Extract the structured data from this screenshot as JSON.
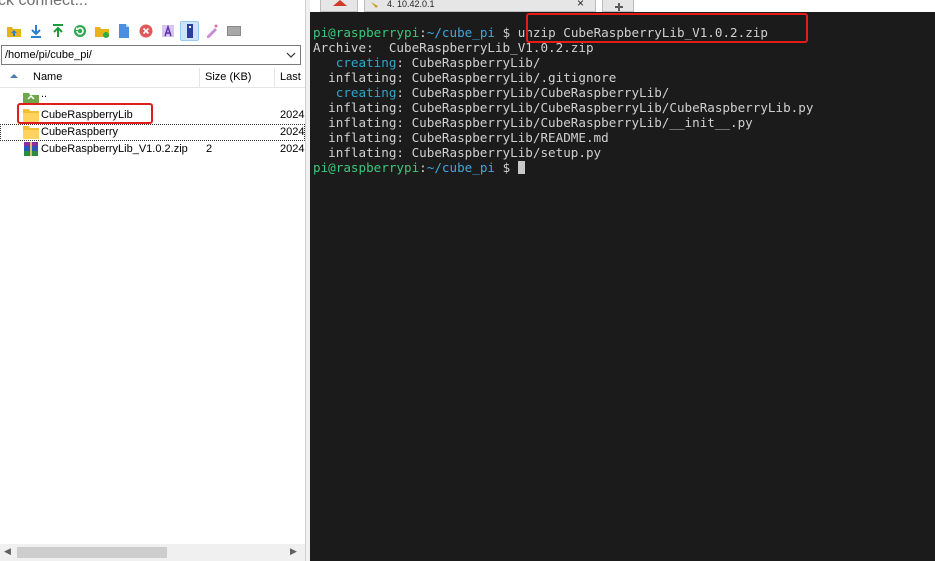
{
  "left_pane": {
    "quick_connect": "ck connect...",
    "path": "/home/pi/cube_pi/",
    "columns": {
      "name": "Name",
      "size": "Size (KB)",
      "last": "Last"
    },
    "files": [
      {
        "name": "..",
        "size": "",
        "date": ""
      },
      {
        "name": "CubeRaspberryLib",
        "size": "",
        "date": "2024"
      },
      {
        "name": "CubeRaspberry",
        "size": "",
        "date": "2024"
      },
      {
        "name": "CubeRaspberryLib_V1.0.2.zip",
        "size": "2",
        "date": "2024"
      }
    ],
    "toolbar_icons": [
      "folder-up-icon",
      "download-icon",
      "upload-icon",
      "refresh-icon",
      "new-folder-icon",
      "new-file-icon",
      "delete-icon",
      "rename-icon",
      "properties-icon",
      "edit-icon",
      "terminal-icon"
    ]
  },
  "terminal": {
    "tab_title": "4. 10.42.0.1",
    "tab_close": "×",
    "prompt_user": "pi@raspberrypi",
    "prompt_sep": ":",
    "prompt_path": "~/cube_pi",
    "prompt_symbol": " $ ",
    "command": "unzip CubeRaspberryLib_V1.0.2.zip",
    "archive_label": "Archive:  ",
    "archive_file": "CubeRaspberryLib_V1.0.2.zip",
    "output": [
      {
        "action": "   creating",
        "path": ": CubeRaspberryLib/",
        "color": "c"
      },
      {
        "action": "  inflating",
        "path": ": CubeRaspberryLib/.gitignore",
        "color": ""
      },
      {
        "action": "   creating",
        "path": ": CubeRaspberryLib/CubeRaspberryLib/",
        "color": "c"
      },
      {
        "action": "  inflating",
        "path": ": CubeRaspberryLib/CubeRaspberryLib/CubeRaspberryLib.py",
        "color": ""
      },
      {
        "action": "  inflating",
        "path": ": CubeRaspberryLib/CubeRaspberryLib/__init__.py",
        "color": ""
      },
      {
        "action": "  inflating",
        "path": ": CubeRaspberryLib/README.md",
        "color": ""
      },
      {
        "action": "  inflating",
        "path": ": CubeRaspberryLib/setup.py",
        "color": ""
      }
    ]
  },
  "colors": {
    "highlight": "#e21b1b",
    "prompt_green": "#3dc67b",
    "prompt_blue": "#3fa8df",
    "terminal_bg": "#1b1b1b"
  }
}
